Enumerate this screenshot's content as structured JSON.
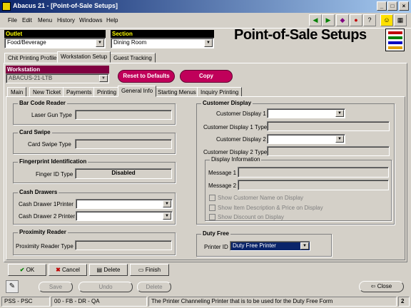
{
  "window": {
    "title": "Abacus 21 - [Point-of-Sale Setups]"
  },
  "menu": [
    "File",
    "Edit",
    "Menu",
    "History",
    "Windows",
    "Help"
  ],
  "header": {
    "outlet_label": "Outlet",
    "outlet_value": "Food/Beverage",
    "section_label": "Section",
    "section_value": "Dining Room",
    "page_title": "Point-of-Sale Setups"
  },
  "top_tabs": [
    "Chit Printing Profile",
    "Workstation Setup",
    "Guest Tracking"
  ],
  "workstation": {
    "label": "Workstation",
    "value": "ABACUS-21-LTB"
  },
  "actions": {
    "reset": "Reset to Defaults",
    "copy": "Copy"
  },
  "sub_tabs": [
    "Main",
    "New Ticket",
    "Payments",
    "Printing",
    "General Info",
    "Starting Menus",
    "Inquiry Printing"
  ],
  "barcode": {
    "title": "Bar Code Reader",
    "label": "Laser Gun Type",
    "value": ""
  },
  "cardswipe": {
    "title": "Card Swipe",
    "label": "Card Swipe Type",
    "value": ""
  },
  "fingerprint": {
    "title": "Fingerprint Identification",
    "label": "Finger ID Type",
    "value": "Disabled"
  },
  "cashdrawers": {
    "title": "Cash Drawers",
    "label1": "Cash Drawer 1Printer",
    "label2": "Cash Drawer 2 Printer"
  },
  "proximity": {
    "title": "Proximity Reader",
    "label": "Proximity Reader Type"
  },
  "customer_display": {
    "title": "Customer Display",
    "cd1": "Customer Display 1",
    "cd1type": "Customer Display 1 Type",
    "cd2": "Customer Display 2",
    "cd2type": "Customer Display 2 Type",
    "info_title": "Display Information",
    "msg1": "Message 1",
    "msg2": "Message 2",
    "chk1": "Show Customer Name on Display",
    "chk2": "Show Item Description & Price on Display",
    "chk3": "Show Discount on Display"
  },
  "dutyfree": {
    "title": "Duty Free",
    "label": "Printer ID",
    "value": "Duty Free Printer"
  },
  "buttons": {
    "ok": "OK",
    "cancel": "Cancel",
    "delete": "Delete",
    "finish": "Finish"
  },
  "bottom_buttons": {
    "save": "Save",
    "undo": "Undo",
    "delete": "Delete",
    "close": "Close"
  },
  "status": {
    "s1": "PSS - PSC",
    "s2": "00 - FB - DR - QA",
    "s3": "The Printer Channeling Printer that is to be used for the Duty Free Form",
    "s4": "2"
  }
}
